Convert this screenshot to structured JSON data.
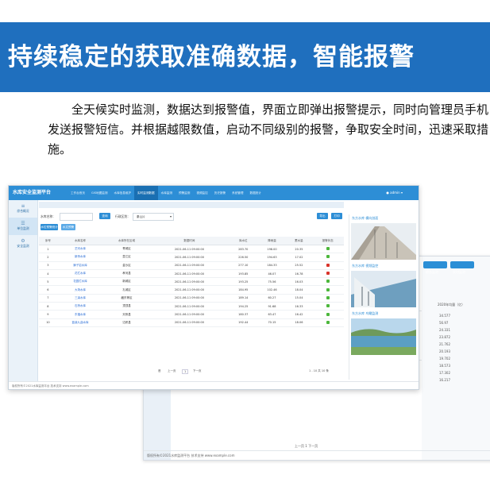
{
  "banner": {
    "title": "持续稳定的获取准确数据，智能报警"
  },
  "intro": {
    "text": "全天候实时监测，数据达到报警值，界面立即弹出报警提示，同时向管理员手机发送报警短信。并根据越限数值，启动不同级别的报警，争取安全时间，迅速采取措施。"
  },
  "app": {
    "title": "水库安全监测平台",
    "nav": [
      "工作台首页",
      "GIS地图监测",
      "水库信息维护",
      "实时监测数据",
      "水库监测",
      "预警监测",
      "视频监控",
      "历史报警",
      "系统管理",
      "数据统计"
    ],
    "user": "admin",
    "sidebar": [
      {
        "icon": "≡",
        "label": "综合概况"
      },
      {
        "icon": "☰",
        "label": "单位监测"
      },
      {
        "icon": "⚙",
        "label": "安全监测"
      }
    ],
    "filter": {
      "label1": "水库名称：",
      "btn_query": "查询",
      "label2": "行政区划：",
      "select_value": "秦山片",
      "btn_export": "导出",
      "btn_print": "打印"
    },
    "subbtns": [
      "水位预警统计",
      "水文预警"
    ],
    "columns": [
      "序号",
      "水库名称",
      "水库所在区域",
      "数据时间",
      "库水位",
      "降雨量",
      "蓄水量",
      "报警状态"
    ],
    "rows": [
      {
        "no": "1",
        "name": "艺河水库",
        "area": "青城区",
        "time": "2021-06-11 09:00:00",
        "v1": "283.70",
        "v2": "198.00",
        "v3": "20.35",
        "status": "green"
      },
      {
        "no": "2",
        "name": "新桥水库",
        "area": "显江区",
        "time": "2021-06-11 09:00:00",
        "v1": "226.50",
        "v2": "194.63",
        "v3": "17.02",
        "status": "green"
      },
      {
        "no": "3",
        "name": "狮子岩水库",
        "area": "金沙区",
        "time": "2021-06-11 09:00:00",
        "v1": "277.10",
        "v2": "184.33",
        "v3": "25.52",
        "status": "red"
      },
      {
        "no": "4",
        "name": "花栏水库",
        "area": "孝河县",
        "time": "2021-06-11 09:00:00",
        "v1": "193.85",
        "v2": "46.07",
        "v3": "16.78",
        "status": "red"
      },
      {
        "no": "5",
        "name": "花园栏水库",
        "area": "新城区",
        "time": "2021-06-11 09:00:00",
        "v1": "193.25",
        "v2": "75.56",
        "v3": "16.03",
        "status": "green"
      },
      {
        "no": "6",
        "name": "大场水库",
        "area": "孔城区",
        "time": "2021-06-11 09:00:00",
        "v1": "184.95",
        "v2": "102.46",
        "v3": "18.04",
        "status": "green"
      },
      {
        "no": "7",
        "name": "三溪水库",
        "area": "藏东等区",
        "time": "2021-06-11 09:00:00",
        "v1": "189.14",
        "v2": "60.27",
        "v3": "15.04",
        "status": "green"
      },
      {
        "no": "8",
        "name": "石桥水库",
        "area": "顶顶县",
        "time": "2021-06-11 09:00:00",
        "v1": "194.25",
        "v2": "91.68",
        "v3": "16.33",
        "status": "green"
      },
      {
        "no": "9",
        "name": "东福水库",
        "area": "天桥县",
        "time": "2021-06-11 09:00:00",
        "v1": "180.37",
        "v2": "63.47",
        "v3": "16.42",
        "status": "green"
      },
      {
        "no": "10",
        "name": "蓝溪九曲水库",
        "area": "达积县",
        "time": "2021-06-11 09:00:00",
        "v1": "192.44",
        "v2": "70.15",
        "v3": "18.06",
        "status": "green"
      }
    ],
    "pager": {
      "first": "首",
      "prev": "上一页",
      "page": "1",
      "next": "下一页",
      "total": "1 - 10 共 10 条"
    },
    "panels": [
      "东方水库 横向剖面",
      "东方水库 视频监控",
      "东方水库 鸟瞰监测"
    ],
    "footer": "版权所有©2021水库监测平台 技术支持 www.example.com"
  },
  "back": {
    "buttons": [
      "综合监测",
      "实时监测"
    ],
    "col_header": "2020年均量（亿）",
    "values": [
      "34.577",
      "56.97",
      "24.331",
      "23.872",
      "21.762",
      "20.193",
      "19.702",
      "18.573",
      "17.302",
      "16.217"
    ],
    "footer": "版权所有©2021水库监测平台 技术支持 www.example.com",
    "pager": "上一页  1  下一页"
  },
  "colors": {
    "primary": "#2d8ed6",
    "banner": "#1f6fbe",
    "alarm_red": "#d9342b",
    "normal_green": "#4cb73c"
  }
}
